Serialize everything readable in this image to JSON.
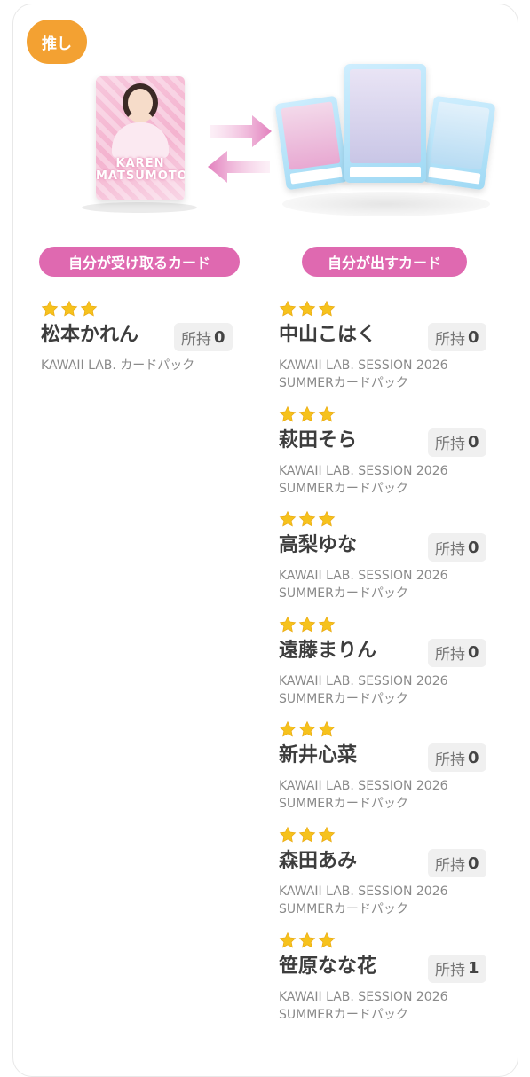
{
  "badge": {
    "label": "推し"
  },
  "received_card_image": {
    "name_text": "KAREN MATSUMOTO"
  },
  "sections": {
    "receive_label": "自分が受け取るカード",
    "give_label": "自分が出すカード"
  },
  "owned_label": "所持",
  "receive_cards": [
    {
      "stars": 3,
      "name": "松本かれん",
      "owned": "0",
      "pack": "KAWAII LAB. カードパック"
    }
  ],
  "give_cards": [
    {
      "stars": 3,
      "name": "中山こはく",
      "owned": "0",
      "pack_line1": "KAWAII LAB. SESSION 2026",
      "pack_line2": "SUMMERカードパック"
    },
    {
      "stars": 3,
      "name": "萩田そら",
      "owned": "0",
      "pack_line1": "KAWAII LAB. SESSION 2026",
      "pack_line2": "SUMMERカードパック"
    },
    {
      "stars": 3,
      "name": "高梨ゆな",
      "owned": "0",
      "pack_line1": "KAWAII LAB. SESSION 2026",
      "pack_line2": "SUMMERカードパック"
    },
    {
      "stars": 3,
      "name": "遠藤まりん",
      "owned": "0",
      "pack_line1": "KAWAII LAB. SESSION 2026",
      "pack_line2": "SUMMERカードパック"
    },
    {
      "stars": 3,
      "name": "新井心菜",
      "owned": "0",
      "pack_line1": "KAWAII LAB. SESSION 2026",
      "pack_line2": "SUMMERカードパック"
    },
    {
      "stars": 3,
      "name": "森田あみ",
      "owned": "0",
      "pack_line1": "KAWAII LAB. SESSION 2026",
      "pack_line2": "SUMMERカードパック"
    },
    {
      "stars": 3,
      "name": "笹原なな花",
      "owned": "1",
      "pack_line1": "KAWAII LAB. SESSION 2026",
      "pack_line2": "SUMMERカードパック"
    }
  ],
  "colors": {
    "badge": "#f3a132",
    "section_label": "#df69b0",
    "star": "#f6c21c",
    "arrow": "#e98fc4"
  },
  "icons": {
    "star": "star-icon",
    "exchange_right": "arrow-right-icon",
    "exchange_left": "arrow-left-icon"
  }
}
